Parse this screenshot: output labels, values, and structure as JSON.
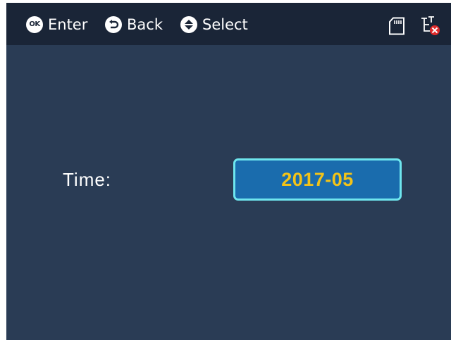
{
  "topbar": {
    "hints": [
      {
        "icon": "ok-icon",
        "icon_text": "OK",
        "label": "Enter"
      },
      {
        "icon": "back-icon",
        "label": "Back"
      },
      {
        "icon": "up-down-select-icon",
        "label": "Select"
      }
    ],
    "status_icons": [
      "sd-card-icon",
      "network-disconnected-icon"
    ]
  },
  "time_setting": {
    "label": "Time:",
    "value": "2017-05"
  },
  "colors": {
    "screen_bg": "#2a3c55",
    "topbar_bg": "#1a2537",
    "field_bg": "#1a6cad",
    "field_border": "#6ee6ee",
    "field_text": "#f2c318",
    "error_red": "#e02a2a"
  }
}
